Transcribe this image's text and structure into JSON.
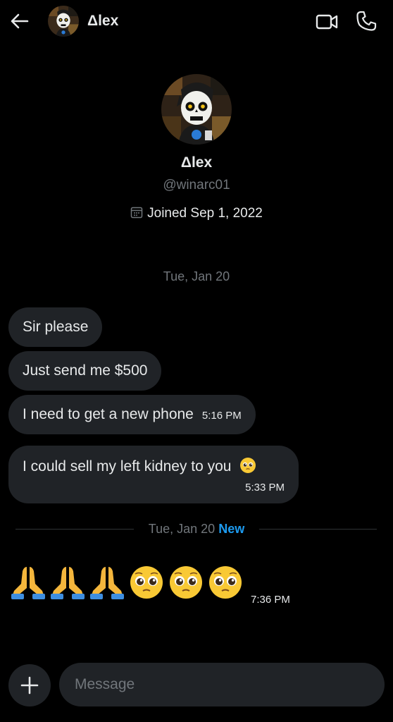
{
  "header": {
    "name": "Δlex",
    "icons": {
      "back": "arrow-left-icon",
      "video": "video-icon",
      "call": "phone-icon"
    }
  },
  "profile": {
    "name": "Δlex",
    "handle": "@winarc01",
    "joined": "Joined Sep 1, 2022",
    "joined_icon": "calendar-icon"
  },
  "conversation": {
    "date_label": "Tue, Jan 20",
    "messages": [
      {
        "text": "Sir please",
        "time": ""
      },
      {
        "text": "Just send me $500",
        "time": ""
      },
      {
        "text": "I need to get a new phone",
        "time": "5:16 PM"
      },
      {
        "text": "I could sell my left kidney to you",
        "emoji": "pleading-face",
        "time": "5:33 PM"
      }
    ],
    "divider": {
      "date": "Tue, Jan 20",
      "badge": "New"
    },
    "emoji_message": {
      "emojis": [
        "🙏",
        "🙏",
        "🙏",
        "🥺",
        "🥺",
        "🥺"
      ],
      "time": "7:36 PM"
    }
  },
  "composer": {
    "placeholder": "Message",
    "add_icon": "plus-icon"
  },
  "colors": {
    "background": "#000000",
    "bubble": "#202327",
    "text": "#e7e9ea",
    "muted": "#71767b",
    "accent": "#1d9bf0"
  }
}
